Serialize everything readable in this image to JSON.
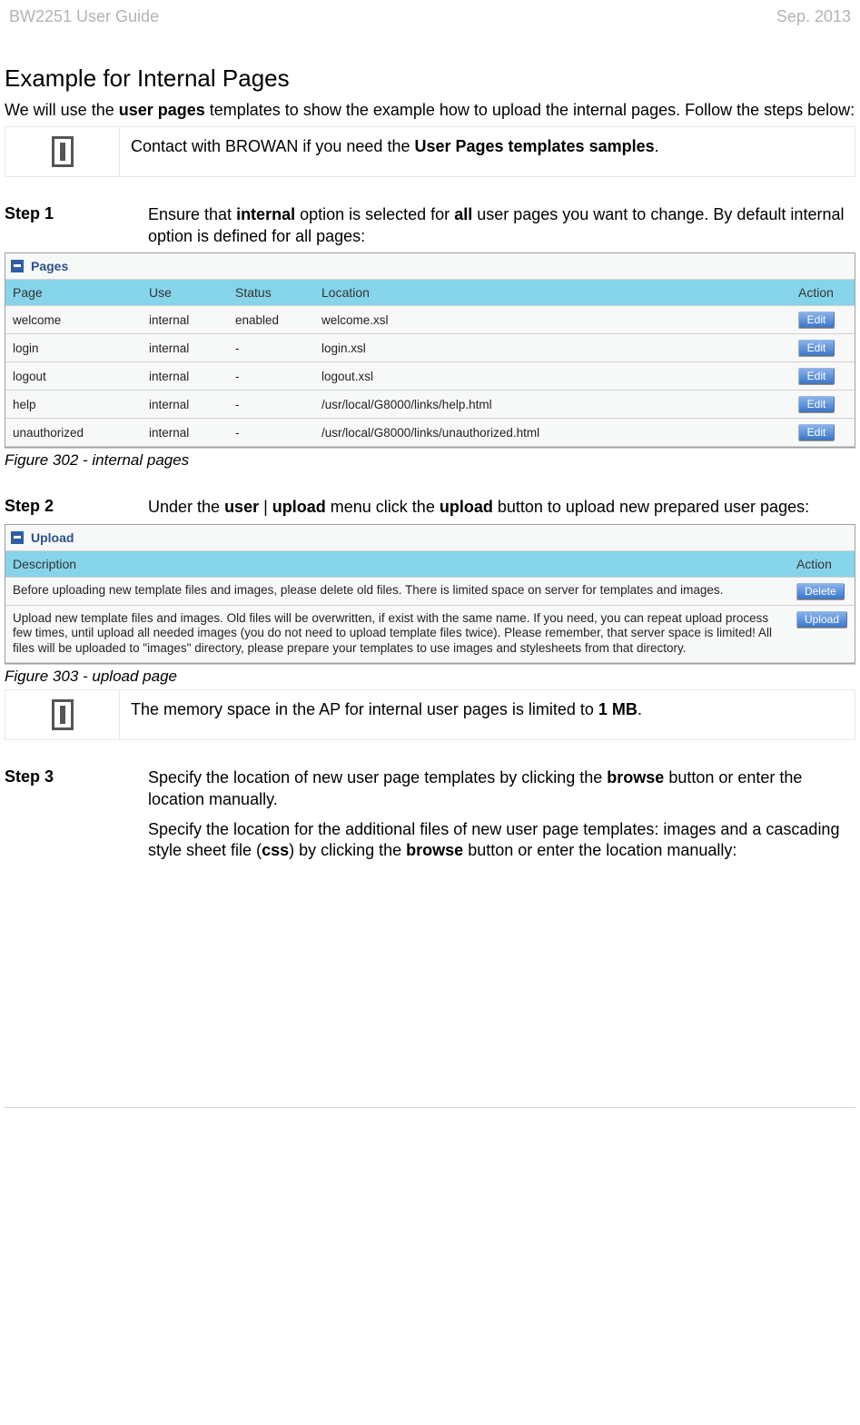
{
  "header": {
    "left": "BW2251 User Guide",
    "right": "Sep. 2013"
  },
  "section_title": "Example for Internal Pages",
  "intro_pre": "We will use the ",
  "intro_bold": "user pages",
  "intro_post": " templates to show the example how to upload the internal pages. Follow the steps below:",
  "note1_pre": "Contact with BROWAN if you need the ",
  "note1_bold": "User Pages templates samples",
  "note1_post": ".",
  "step1": {
    "label": "Step 1",
    "pre": "Ensure that ",
    "b1": "internal",
    "mid1": " option is selected for ",
    "b2": "all",
    "post": " user pages you want to change. By default internal option is defined for all pages:"
  },
  "pages_panel": {
    "title": "Pages",
    "headers": [
      "Page",
      "Use",
      "Status",
      "Location",
      "Action"
    ],
    "rows": [
      {
        "page": "welcome",
        "use": "internal",
        "status": "enabled",
        "location": "welcome.xsl",
        "action": "Edit"
      },
      {
        "page": "login",
        "use": "internal",
        "status": "-",
        "location": "login.xsl",
        "action": "Edit"
      },
      {
        "page": "logout",
        "use": "internal",
        "status": "-",
        "location": "logout.xsl",
        "action": "Edit"
      },
      {
        "page": "help",
        "use": "internal",
        "status": "-",
        "location": "/usr/local/G8000/links/help.html",
        "action": "Edit"
      },
      {
        "page": "unauthorized",
        "use": "internal",
        "status": "-",
        "location": "/usr/local/G8000/links/unauthorized.html",
        "action": "Edit"
      }
    ]
  },
  "fig302": "Figure 302 - internal pages",
  "step2": {
    "label": "Step 2",
    "pre": "Under the ",
    "b1": "user",
    "sep": " | ",
    "b2": "upload",
    "mid": " menu click the ",
    "b3": "upload",
    "post": " button to upload new prepared user pages:"
  },
  "upload_panel": {
    "title": "Upload",
    "headers": [
      "Description",
      "Action"
    ],
    "rows": [
      {
        "desc": "Before uploading new template files and images, please delete old files. There is limited space on server for templates and images.",
        "action": "Delete"
      },
      {
        "desc": "Upload new template files and images. Old files will be overwritten, if exist with the same name. If you need, you can repeat upload process few times, until upload all needed images (you do not need to upload template files twice). Please remember, that server space is limited! All files will be uploaded to \"images\" directory, please prepare your templates to use images and stylesheets from that directory.",
        "action": "Upload"
      }
    ]
  },
  "fig303": "Figure 303 - upload page",
  "note2_pre": "The memory space in the AP for internal user pages is limited to ",
  "note2_bold": "1 MB",
  "note2_post": ".",
  "step3": {
    "label": "Step 3",
    "p1_pre": "Specify the location of new user page templates by clicking the ",
    "p1_b": "browse",
    "p1_post": " button or enter the location manually.",
    "p2_pre": "Specify the location for the additional files of new user page templates: images and a cascading style sheet file (",
    "p2_b1": "css",
    "p2_mid": ") by clicking the ",
    "p2_b2": "browse",
    "p2_post": " button or enter the location manually:"
  }
}
